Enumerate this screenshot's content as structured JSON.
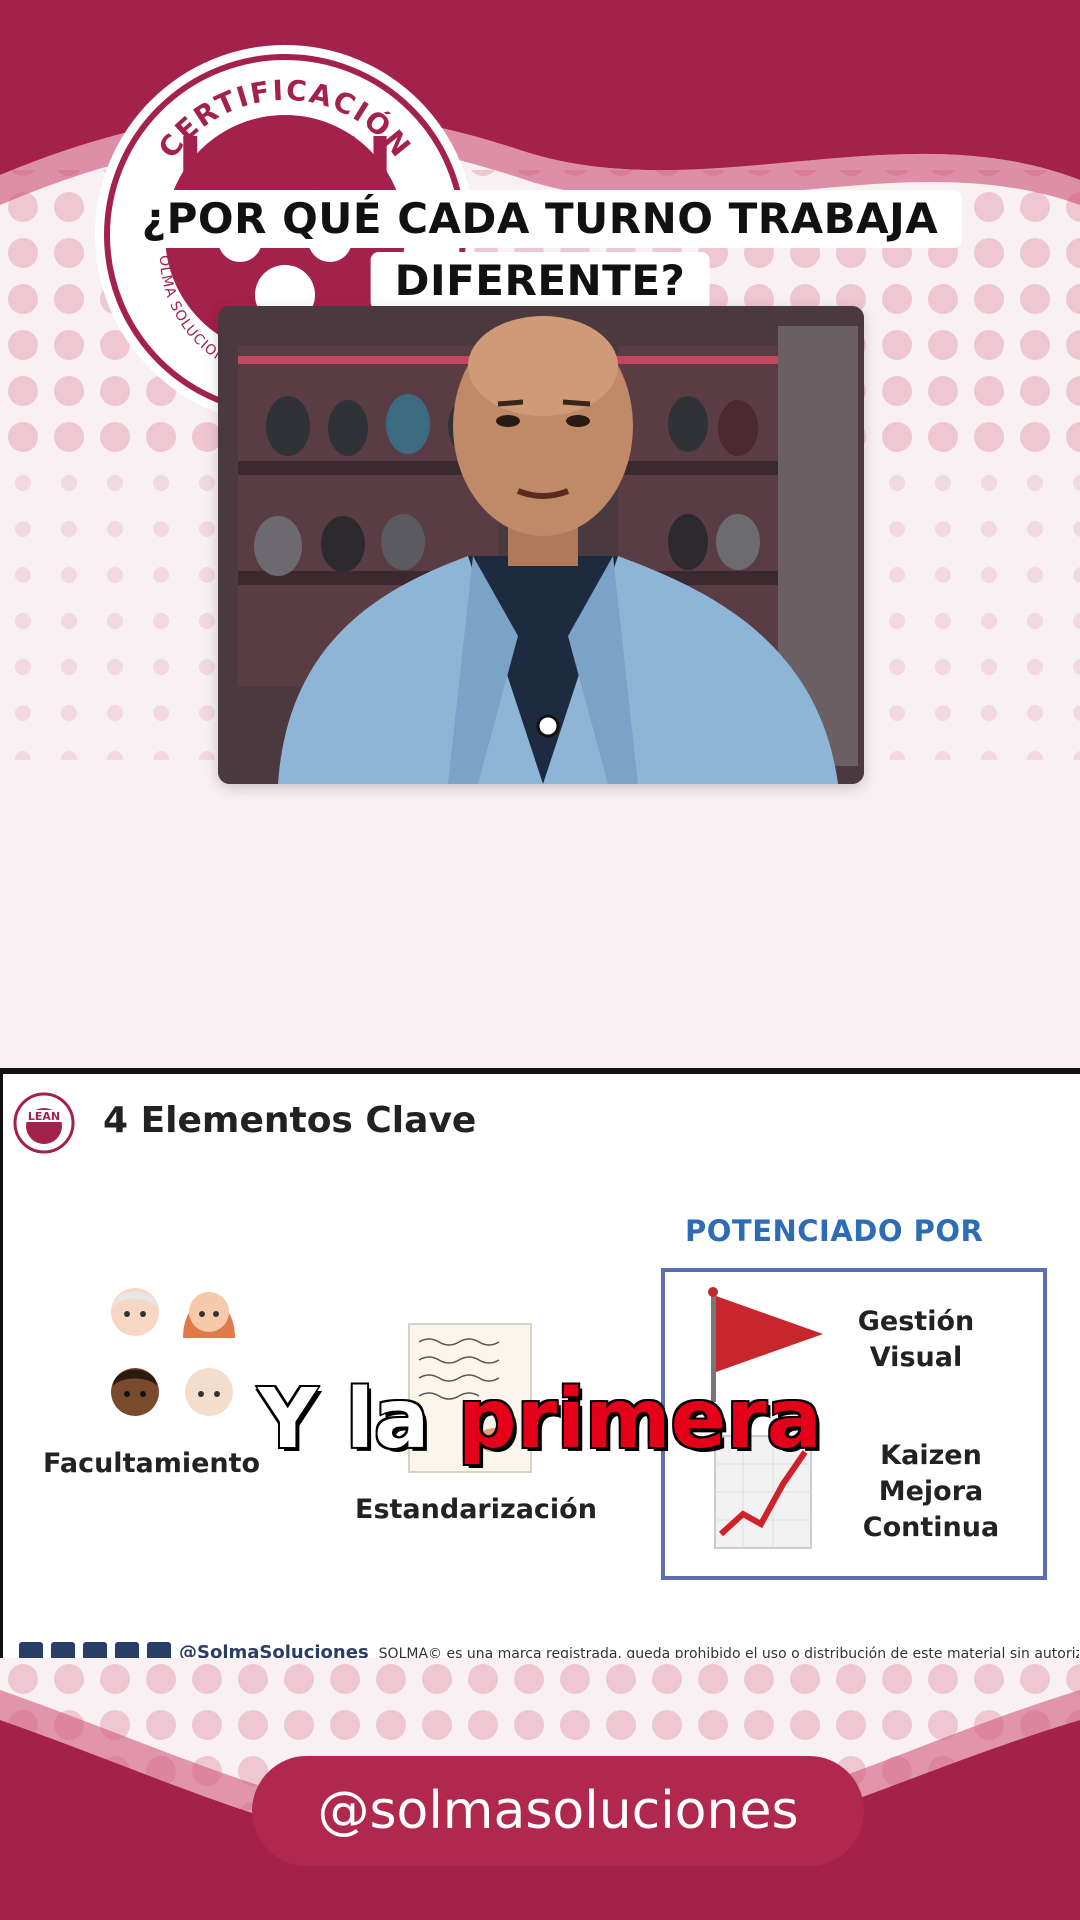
{
  "badge": {
    "top_text": "CERTIFICACIÓN",
    "brand": "LEAN",
    "bottom_text": "SOLMA SOLUCIONES"
  },
  "title": {
    "line1": "¿POR QUÉ CADA TURNO TRABAJA",
    "line2": "DIFERENTE?"
  },
  "slide": {
    "title": "4 Elementos Clave",
    "facultamiento": "Facultamiento",
    "estandarizacion": "Estandarización",
    "potenciado_por": "POTENCIADO POR",
    "gestion_visual": [
      "Gestión",
      "Visual"
    ],
    "kaizen": [
      "Kaizen",
      "Mejora",
      "Continua"
    ],
    "footer_handle": "@SolmaSoluciones",
    "footer_text": "SOLMA© es una marca registrada, queda prohibido el uso o distribución de este material sin autorización"
  },
  "caption": {
    "white": "Y la",
    "red": "primera"
  },
  "handle": "@solmasoluciones",
  "colors": {
    "brand_magenta": "#a3214a",
    "pill": "#b0284e",
    "caption_red": "#e5001a",
    "potenciado_blue": "#2d6db5",
    "box_border": "#5b6fb1"
  }
}
